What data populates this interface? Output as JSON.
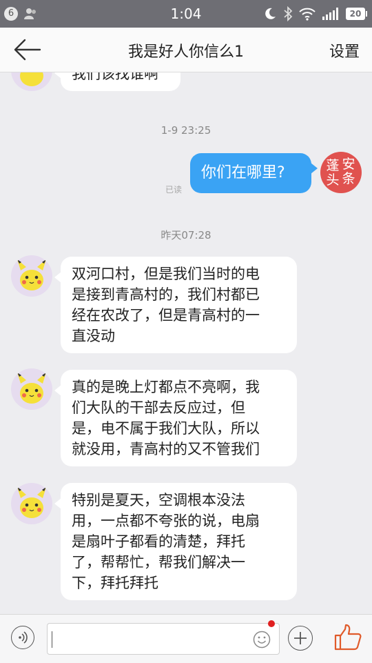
{
  "status_bar": {
    "notification_count": "6",
    "time": "1:04",
    "battery": "20",
    "icons": [
      "person-icon",
      "moon-icon",
      "bluetooth-icon",
      "wifi-icon",
      "signal-icon",
      "battery-icon"
    ]
  },
  "header": {
    "back_icon": "arrow-left-icon",
    "title": "我是好人你信么1",
    "settings_label": "设置"
  },
  "chat": {
    "partial_message": "我们该找谁啊",
    "timestamp_1": "1-9 23:25",
    "my_message": "你们在哪里?",
    "read_status": "已读",
    "my_avatar_chars": [
      "蓬",
      "安",
      "头",
      "条"
    ],
    "timestamp_2": "昨天07:28",
    "messages": [
      {
        "lines": [
          "双河口村，但是我们当时的电",
          "是接到青高村的，我们村都已",
          "经在农改了，但是青高村的一",
          "直没动"
        ]
      },
      {
        "lines": [
          "真的是晚上灯都点不亮啊，我",
          "们大队的干部去反应过，但",
          "是，电不属于我们大队，所以",
          "就没用，青高村的又不管我们"
        ]
      },
      {
        "lines": [
          "特别是夏天，空调根本没法",
          "用，一点都不夸张的说，电扇",
          "是扇叶子都看的清楚，拜托",
          "了，帮帮忙，帮我们解决一",
          "下，拜托拜托"
        ]
      }
    ]
  },
  "input_bar": {
    "icons": [
      "voice-icon",
      "emoji-icon",
      "plus-icon",
      "thumbs-up-icon"
    ],
    "text_value": "",
    "accent_color": "#e05a2a"
  },
  "colors": {
    "status_bar": "#6e6e74",
    "background": "#ededf0",
    "outgoing_bubble": "#3aa3f4",
    "my_avatar": "#e0524f"
  }
}
